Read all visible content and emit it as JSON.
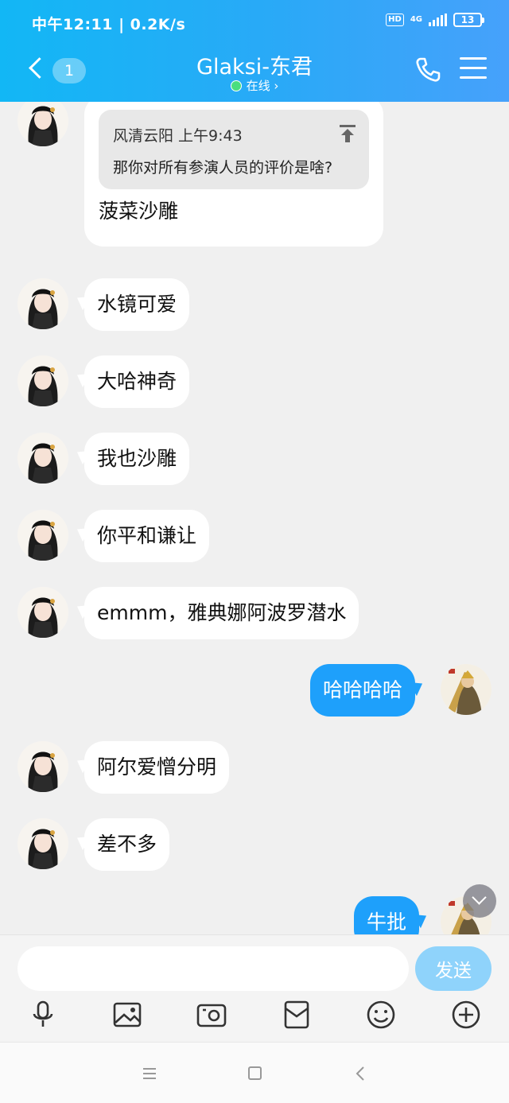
{
  "status_bar": {
    "time_speed": "中午12:11 | 0.2K/s",
    "hd": "HD",
    "network": "4G",
    "battery": "13"
  },
  "header": {
    "unread_count": "1",
    "title": "Glaksi-东君",
    "status": "在线 ›"
  },
  "quoted_message": {
    "meta": "风清云阳 上午9:43",
    "text": "那你对所有参演人员的评价是啥?",
    "reply": "菠菜沙雕"
  },
  "messages": [
    {
      "side": "left",
      "text": "水镜可爱"
    },
    {
      "side": "left",
      "text": "大哈神奇"
    },
    {
      "side": "left",
      "text": "我也沙雕"
    },
    {
      "side": "left",
      "text": "你平和谦让"
    },
    {
      "side": "left",
      "text": "emmm，雅典娜阿波罗潜水"
    },
    {
      "side": "right",
      "text": "哈哈哈哈"
    },
    {
      "side": "left",
      "text": "阿尔爱憎分明"
    },
    {
      "side": "left",
      "text": "差不多"
    },
    {
      "side": "right",
      "text": "牛批"
    }
  ],
  "input": {
    "value": "",
    "send_label": "发送"
  },
  "toolbar_icons": [
    "microphone-icon",
    "image-icon",
    "camera-icon",
    "red-packet-icon",
    "emoji-icon",
    "plus-icon"
  ],
  "colors": {
    "header_gradient_start": "#12b7f5",
    "header_gradient_end": "#46a1fb",
    "my_bubble": "#1ea0fb",
    "send_button": "#8fd3fb",
    "online_dot": "#4ade80"
  }
}
